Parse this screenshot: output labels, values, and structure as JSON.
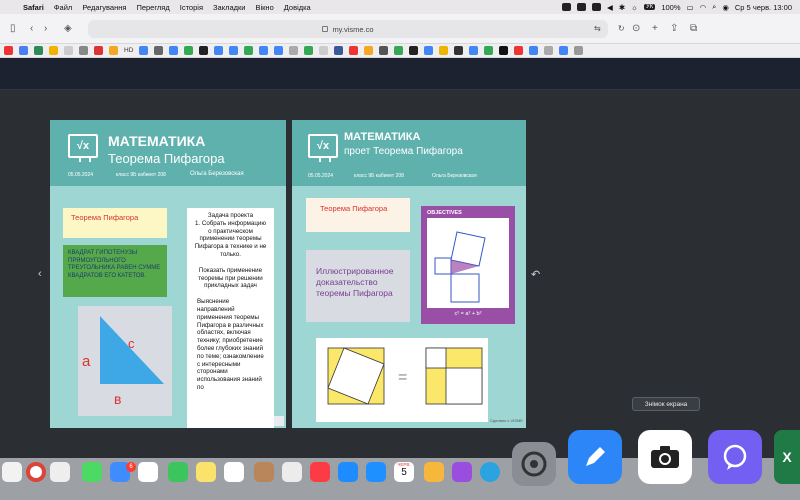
{
  "menubar": {
    "app": "Safari",
    "items": [
      "Файл",
      "Редагування",
      "Перегляд",
      "Історія",
      "Закладки",
      "Вікно",
      "Довідка"
    ],
    "keyboard": "УК",
    "battery": "100%",
    "datetime": "Ср 5 черв.  13:00"
  },
  "toolbar": {
    "url": "my.visme.co"
  },
  "favorites": [
    "HD"
  ],
  "slides": {
    "left": {
      "title": "МАТЕМАТИКА",
      "subtitle": "Теорема Пифагора",
      "date": "05.05.2024",
      "class_info": "класс 9Б кабинет 208",
      "author": "Ольга Березовская",
      "box1": "Теорема Пифагора",
      "box2": "КВАДРАТ ГИПОТЕНУЗЫ ПРЯМОУГОЛЬНОГО ТРЕУГОЛЬНИКА РАВЕН СУММЕ КВАДРАТОВ ЕГО КАТЕТОВ.",
      "triangle_a": "а",
      "triangle_b": "в",
      "triangle_c": "с",
      "task_title": "Задача проекта",
      "task_item1": "1. Собрать информацию о практическом применении теоремы Пифагора в технике и не только.",
      "task_item2": "Показать применение теоремы при решении прикладных задач",
      "task_item3": "Выяснение направлений применения теоремы Пифагора в различных областях, включая технику; приобретение более глубоких знаний по теме; ознакомление с интересными сторонами использования знаний по"
    },
    "right": {
      "title": "МАТЕМАТИКА",
      "subtitle": "проет Теорема Пифагора",
      "date": "05.05.2024",
      "class_info": "класс 9Б кабинет 208",
      "author": "Ольга Березовская",
      "box1": "Теорема Пифагора",
      "box2": "Иллюстрированное доказательство теоремы Пифагора",
      "objectives_label": "OBJECTIVES",
      "formula": "c² = a² + b²",
      "proof_equals": "=",
      "credit": "Сделано с VISME"
    }
  },
  "tooltip": "Знімок екрана",
  "dock": {
    "calendar_month": "ЧЕРВ.",
    "calendar_day": "5",
    "badge": "6"
  },
  "colors": {
    "page_bg": "#9ed6d4",
    "banner": "#5fb1ae",
    "accent_red": "#d9342b",
    "accent_purple": "#7a3d91",
    "objectives_bg": "#9a4fa7"
  }
}
